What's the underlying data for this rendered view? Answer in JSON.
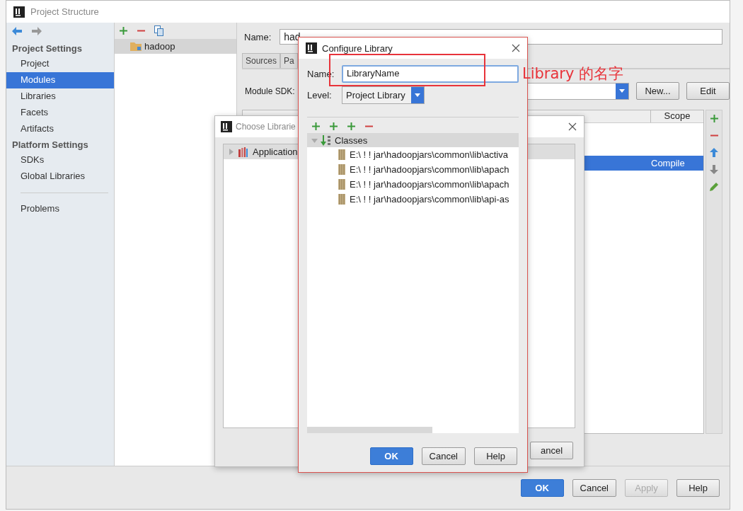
{
  "window": {
    "title": "Project Structure"
  },
  "sidebar": {
    "sections": [
      {
        "heading": "Project Settings",
        "items": [
          {
            "label": "Project",
            "selected": false
          },
          {
            "label": "Modules",
            "selected": true
          },
          {
            "label": "Libraries",
            "selected": false
          },
          {
            "label": "Facets",
            "selected": false
          },
          {
            "label": "Artifacts",
            "selected": false
          }
        ]
      },
      {
        "heading": "Platform Settings",
        "items": [
          {
            "label": "SDKs",
            "selected": false
          },
          {
            "label": "Global Libraries",
            "selected": false
          }
        ]
      }
    ],
    "footer_items": [
      {
        "label": "Problems",
        "selected": false
      }
    ]
  },
  "modules": [
    {
      "name": "hadoop",
      "selected": true
    }
  ],
  "module_name": {
    "label": "Name:",
    "value": "had"
  },
  "tabs": [
    {
      "label": "Sources",
      "selected": false
    },
    {
      "label": "Pa",
      "selected": false
    }
  ],
  "module_sdk": {
    "label": "Module SDK:",
    "buttons": [
      "New...",
      "Edit"
    ]
  },
  "dependencies": {
    "columns": [
      {
        "label": "Scope"
      }
    ],
    "rows": [
      {
        "scope": "Compile",
        "selected": true
      }
    ]
  },
  "footer_buttons": [
    {
      "label": "OK",
      "default": true,
      "disabled": false
    },
    {
      "label": "Cancel",
      "default": false,
      "disabled": false
    },
    {
      "label": "Apply",
      "default": false,
      "disabled": true
    },
    {
      "label": "Help",
      "default": false,
      "disabled": false
    }
  ],
  "choose_dialog": {
    "title": "Choose Librarie",
    "items": [
      {
        "label": "Application",
        "expanded": false
      }
    ],
    "buttons": [
      "ancel"
    ]
  },
  "configure_dialog": {
    "title": "Configure Library",
    "name": {
      "label": "Name:",
      "value": "LibraryName"
    },
    "level": {
      "label": "Level:",
      "value": "Project Library"
    },
    "tree": {
      "label": "Classes",
      "expanded": true,
      "children": [
        {
          "label": "E:\\ ! ! jar\\hadoopjars\\common\\lib\\activa"
        },
        {
          "label": "E:\\ ! ! jar\\hadoopjars\\common\\lib\\apach"
        },
        {
          "label": "E:\\ ! ! jar\\hadoopjars\\common\\lib\\apach"
        },
        {
          "label": "E:\\ ! ! jar\\hadoopjars\\common\\lib\\api-as"
        }
      ]
    },
    "buttons": [
      {
        "label": "OK",
        "default": true
      },
      {
        "label": "Cancel",
        "default": false
      },
      {
        "label": "Help",
        "default": false
      }
    ]
  },
  "annotation": {
    "text": "Library 的名字"
  }
}
